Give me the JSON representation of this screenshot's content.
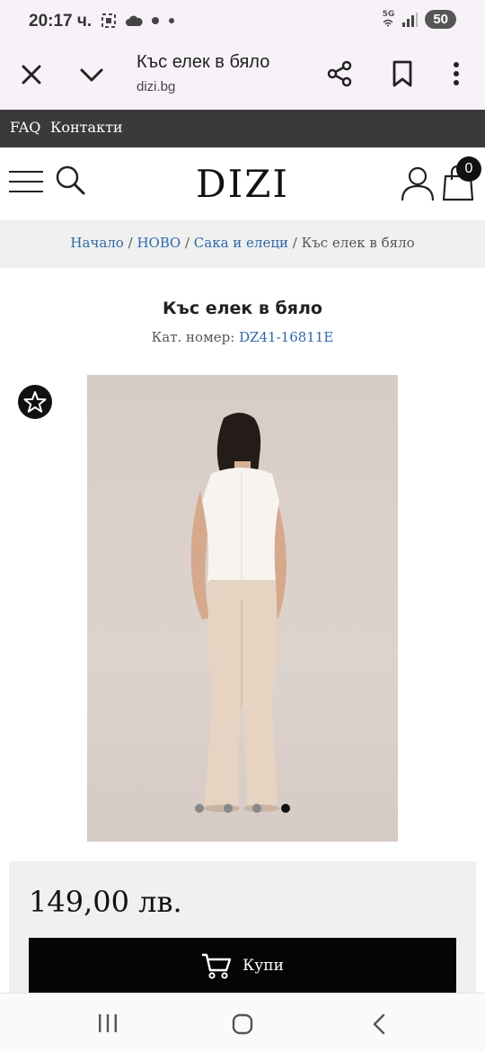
{
  "status_bar": {
    "time": "20:17 ч.",
    "network": "5G",
    "battery": "50",
    "icons": [
      "screenshot-icon",
      "cloud-icon",
      "dot-icon",
      "dot-icon",
      "wifi-icon",
      "signal-icon"
    ]
  },
  "browser": {
    "page_title": "Къс елек в бяло",
    "url": "dizi.bg",
    "icons": [
      "close-icon",
      "chevron-down-icon",
      "share-icon",
      "bookmark-icon",
      "more-icon"
    ]
  },
  "top_links": {
    "faq": "FAQ",
    "contacts": "Контакти"
  },
  "header": {
    "logo": "DIZI",
    "cart_count": "0",
    "icons": [
      "menu-icon",
      "search-icon",
      "user-icon",
      "cart-icon"
    ]
  },
  "breadcrumb": {
    "items": [
      "Начало",
      "НОВО",
      "Сака и елеци"
    ],
    "separator": "/",
    "current": "Къс елек в бяло"
  },
  "product": {
    "title": "Къс елек в бяло",
    "code_label": "Кат. номер:",
    "code": "DZ41-16811E",
    "image_count": 4,
    "active_image": 4,
    "price": "149,00 лв.",
    "buy_label": "Купи"
  },
  "nav_bar": {
    "icons": [
      "recents-icon",
      "home-icon",
      "back-icon"
    ]
  },
  "colors": {
    "accent_link": "#2d68a8",
    "top_bar": "#3a3a3a",
    "buy_button": "#050505",
    "panel_bg": "#f0f0f0"
  }
}
